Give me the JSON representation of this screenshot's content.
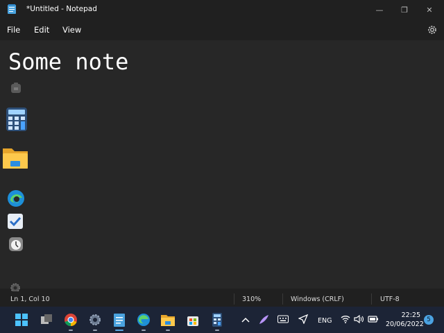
{
  "window": {
    "title": "*Untitled - Notepad",
    "controls": {
      "minimize": "—",
      "maximize": "❐",
      "close": "✕"
    }
  },
  "menu": {
    "items": [
      "File",
      "Edit",
      "View"
    ]
  },
  "editor": {
    "content": "Some note"
  },
  "desktop_icons": [
    "app-icon",
    "calculator-icon",
    "folder-icon",
    "edge-icon",
    "checkbox-app-icon",
    "clock-icon",
    "settings-gear-icon"
  ],
  "status": {
    "position": "Ln 1, Col 10",
    "zoom": "310%",
    "line_ending": "Windows (CRLF)",
    "encoding": "UTF-8"
  },
  "taskbar": {
    "apps": [
      "start-icon",
      "task-view-icon",
      "chrome-icon",
      "settings-icon",
      "notepad-icon",
      "edge-icon",
      "file-explorer-icon",
      "store-icon",
      "calculator-icon"
    ],
    "tray": {
      "language": "ENG",
      "time": "22:25",
      "date": "20/06/2022",
      "notification_count": "5"
    }
  },
  "colors": {
    "background": "#202020",
    "editor": "#272727",
    "taskbar": "#1c2436",
    "accent": "#0078d4"
  }
}
